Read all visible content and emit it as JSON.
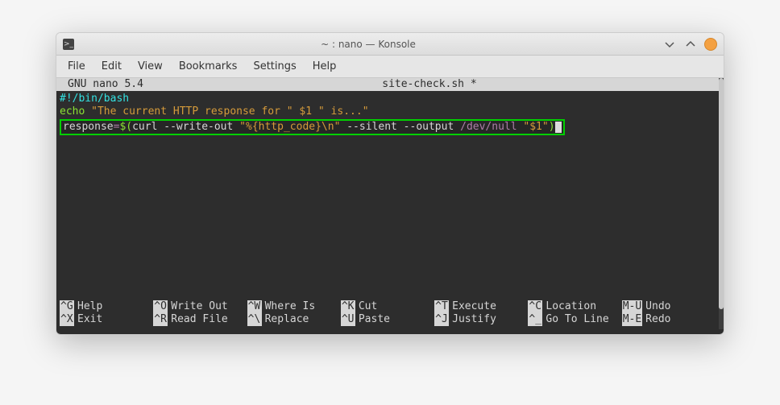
{
  "titlebar": {
    "title": "~ : nano — Konsole"
  },
  "menubar": {
    "file": "File",
    "edit": "Edit",
    "view": "View",
    "bookmarks": "Bookmarks",
    "settings": "Settings",
    "help": "Help"
  },
  "nano": {
    "version_label": "GNU nano 5.4",
    "filename": "site-check.sh *",
    "lines": {
      "l1": "#!/bin/bash",
      "l2_echo": "echo ",
      "l2_str1": "\"The current HTTP response for \"",
      "l2_var": " $1 ",
      "l2_str2": "\" is...\"",
      "l3_lhs": "response",
      "l3_eq": "=",
      "l3_sub_open": "$(",
      "l3_cmd": "curl --write-out ",
      "l3_fmt": "\"%{http_code}\\n\"",
      "l3_flags": " --silent --output ",
      "l3_devnull": "/dev/null",
      "l3_sp": " ",
      "l3_arg": "\"$1\"",
      "l3_sub_close": ")"
    }
  },
  "shortcuts": {
    "row1": [
      {
        "key": "^G",
        "label": "Help"
      },
      {
        "key": "^O",
        "label": "Write Out"
      },
      {
        "key": "^W",
        "label": "Where Is"
      },
      {
        "key": "^K",
        "label": "Cut"
      },
      {
        "key": "^T",
        "label": "Execute"
      },
      {
        "key": "^C",
        "label": "Location"
      },
      {
        "key": "M-U",
        "label": "Undo"
      }
    ],
    "row2": [
      {
        "key": "^X",
        "label": "Exit"
      },
      {
        "key": "^R",
        "label": "Read File"
      },
      {
        "key": "^\\",
        "label": "Replace"
      },
      {
        "key": "^U",
        "label": "Paste"
      },
      {
        "key": "^J",
        "label": "Justify"
      },
      {
        "key": "^_",
        "label": "Go To Line"
      },
      {
        "key": "M-E",
        "label": "Redo"
      }
    ]
  }
}
